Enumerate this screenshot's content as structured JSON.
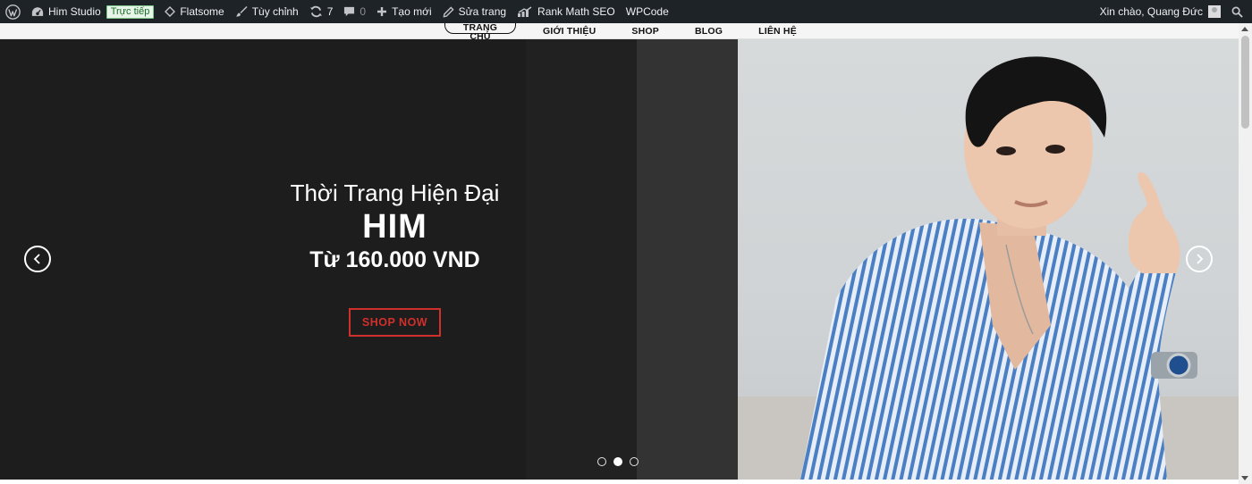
{
  "adminbar": {
    "site_name": "Him Studio",
    "live_badge": "Trực tiếp",
    "theme": "Flatsome",
    "customize": "Tùy chỉnh",
    "updates_count": "7",
    "comments_count": "0",
    "new_label": "Tạo mới",
    "edit_page": "Sửa trang",
    "rank_math": "Rank Math SEO",
    "wpcode": "WPCode",
    "greeting": "Xin chào, Quang Đức"
  },
  "nav": {
    "items": [
      {
        "label": "TRANG CHỦ"
      },
      {
        "label": "GIỚI THIỆU"
      },
      {
        "label": "SHOP"
      },
      {
        "label": "BLOG"
      },
      {
        "label": "LIÊN HỆ"
      }
    ],
    "active_index": 0
  },
  "slider": {
    "subtitle": "Thời Trang Hiện Đại",
    "title": "HIM",
    "price": "Từ 160.000 VND",
    "cta": "SHOP NOW",
    "slide_count": 3,
    "active_slide": 2
  },
  "colors": {
    "adminbar_bg": "#1d2327",
    "accent_red": "#d0302c",
    "live_badge_bg": "#e7f5e9",
    "shirt_blue": "#4a7fc4"
  },
  "icons": {
    "wp_logo": "wordpress-icon",
    "site": "dashboard-icon",
    "theme": "diamond-icon",
    "customize": "brush-icon",
    "updates": "refresh-icon",
    "comments": "comment-icon",
    "new": "plus-icon",
    "edit": "pencil-icon",
    "rank_math": "chart-icon",
    "search": "search-icon",
    "prev": "chevron-left-icon",
    "next": "chevron-right-icon"
  }
}
